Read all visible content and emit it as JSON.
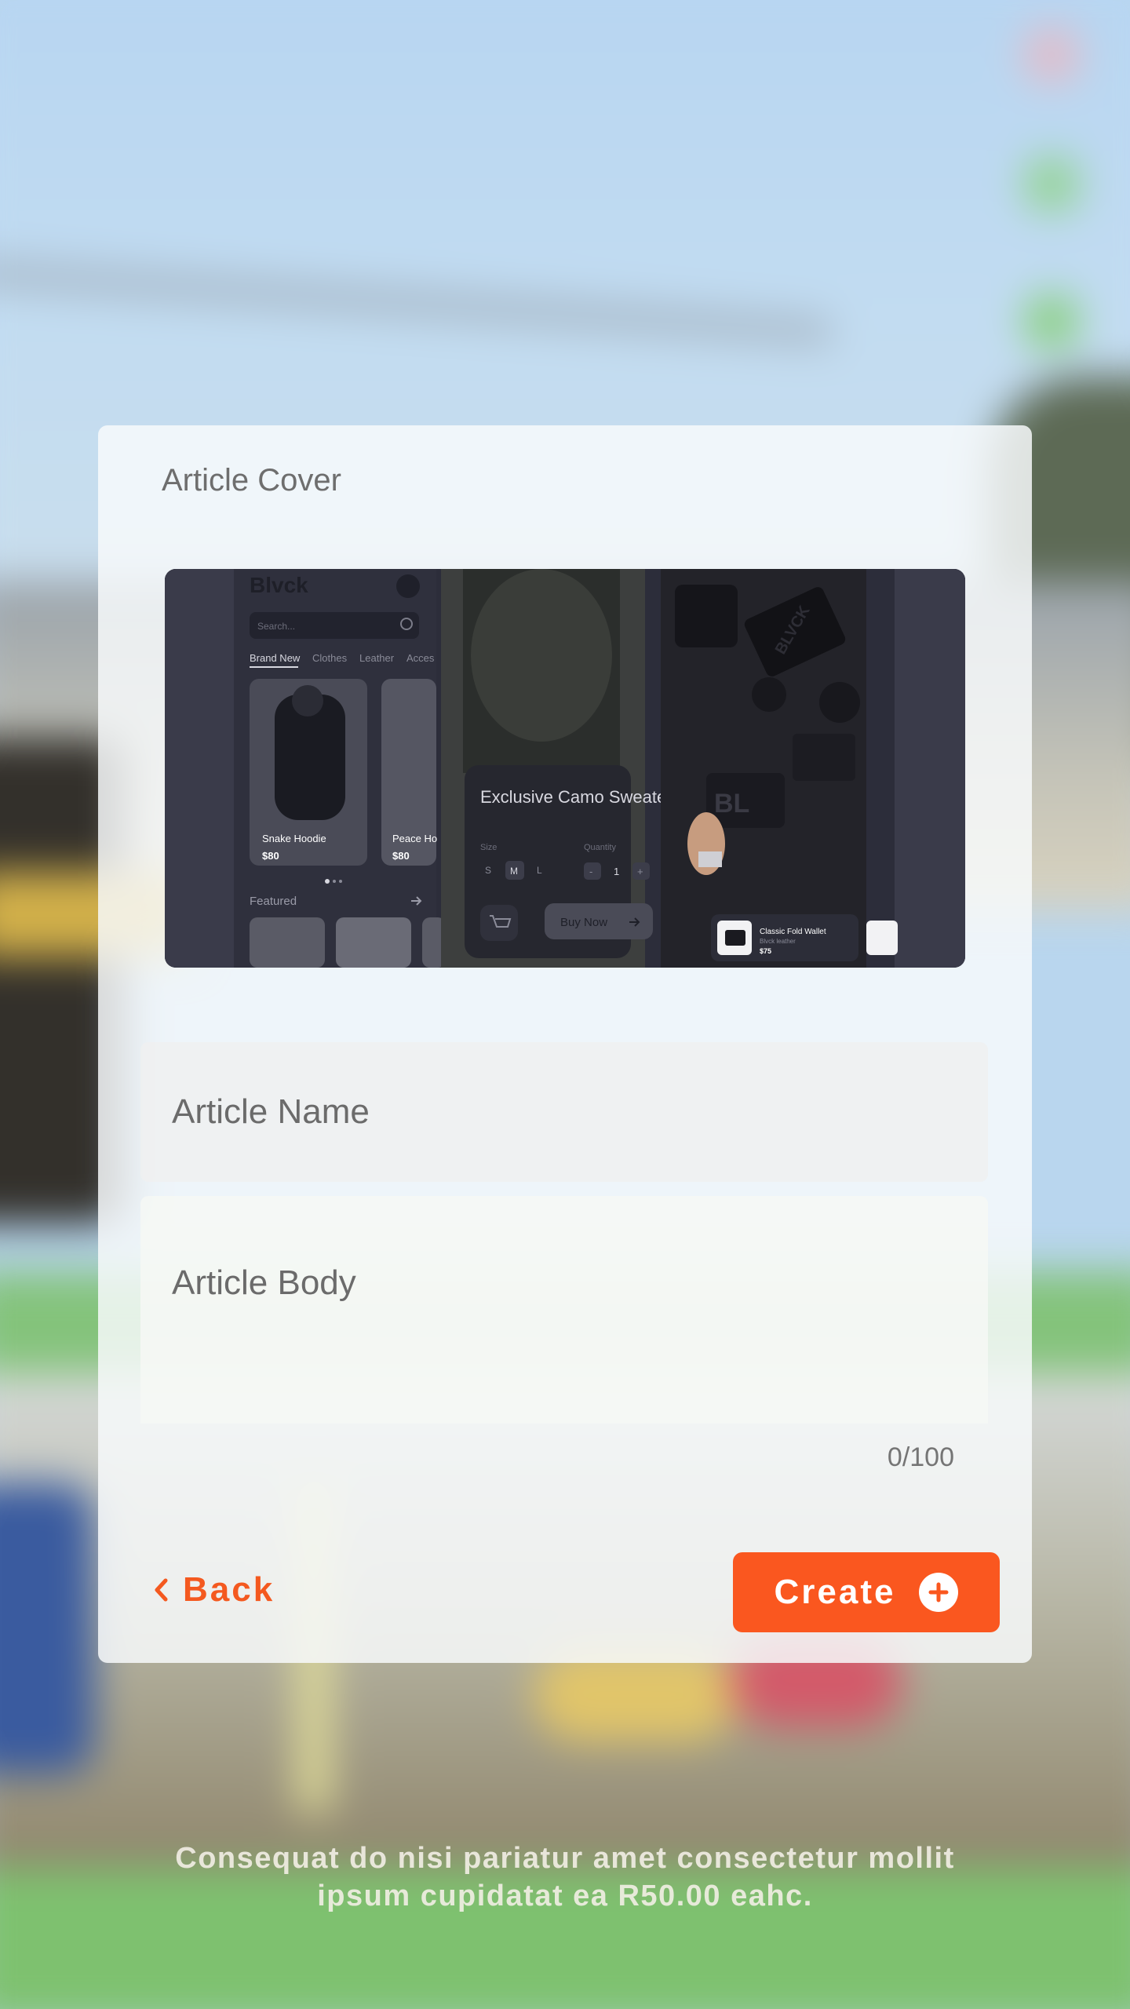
{
  "cover": {
    "label": "Article Cover",
    "image": {
      "brand": "Blvck",
      "search_placeholder": "Search...",
      "tabs": [
        "Brand New",
        "Clothes",
        "Leather",
        "Acces"
      ],
      "products": [
        {
          "name": "Snake Hoodie",
          "price": "$80"
        },
        {
          "name": "Peace Ho",
          "price": "$80"
        }
      ],
      "featured_label": "Featured",
      "detail": {
        "title": "Exclusive Camo Sweater",
        "size_label": "Size",
        "sizes": [
          "S",
          "M",
          "L"
        ],
        "quantity_label": "Quantity",
        "quantity": "1",
        "minus": "-",
        "plus": "+",
        "buy_label": "Buy Now"
      },
      "accessory": {
        "name": "Classic Fold Wallet",
        "subtitle": "Blvck leather",
        "price": "$75",
        "badge_text": "BLVCK",
        "card_text": "BL"
      }
    }
  },
  "form": {
    "name_placeholder": "Article Name",
    "body_placeholder": "Article Body",
    "char_count": "0/100"
  },
  "actions": {
    "back_label": "Back",
    "create_label": "Create"
  },
  "footer_text": "Consequat do nisi pariatur amet consectetur mollit ipsum cupidatat ea R50.00 eahc.",
  "colors": {
    "accent": "#fa571f",
    "card": "#f8fafc",
    "cover_bg": "#2c2d3a"
  }
}
